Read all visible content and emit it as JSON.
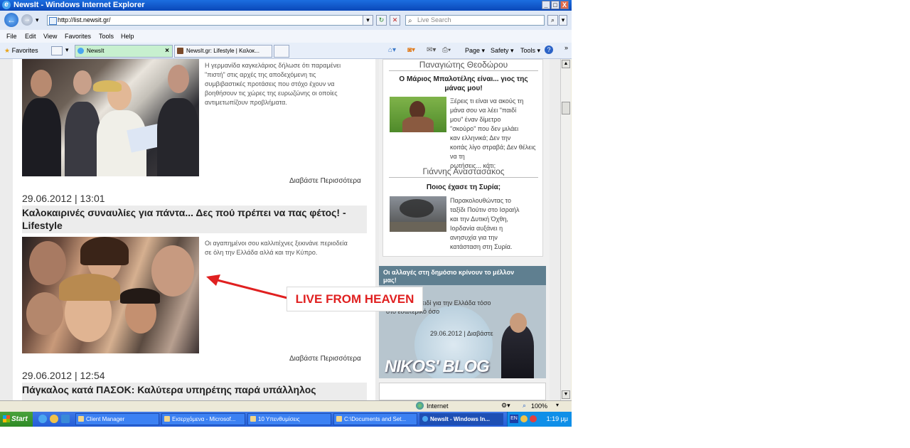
{
  "window": {
    "title": "NewsIt - Windows Internet Explorer",
    "minimize": "_",
    "maximize": "□",
    "close": "X"
  },
  "address": {
    "back": "←",
    "forward": "→",
    "url": "http://list.newsit.gr/",
    "dropdown": "▾",
    "refresh": "↻",
    "stop": "✕",
    "search_placeholder": "Live Search",
    "search_btn": "⌕"
  },
  "menu": [
    "File",
    "Edit",
    "View",
    "Favorites",
    "Tools",
    "Help"
  ],
  "favorites_bar": {
    "label": "Favorites",
    "tabs": [
      {
        "label": "NewsIt",
        "active": true
      },
      {
        "label": "NewsIt.gr: Lifestyle | Καλοκ...",
        "active": false
      }
    ],
    "commands": [
      "Page ▾",
      "Safety ▾",
      "Tools ▾"
    ]
  },
  "articles": [
    {
      "excerpt": [
        "Η γερμανίδα καγκελάριος δήλωσε ότι παραμένει",
        "\"πιστή\" στις αρχές της αποδεχόμενη τις",
        "συμβιβαστικές προτάσεις που στόχο έχουν να",
        "βοηθήσουν τις χώρες της ευρωζώνης οι οποίες",
        "αντιμετωπίζουν προβλήματα."
      ],
      "read_more": "Διαβάστε Περισσότερα"
    },
    {
      "date": "29.06.2012 | 13:01",
      "headline": "Καλοκαιρινές συναυλίες για πάντα... Δες πού πρέπει να πας φέτος! - Lifestyle",
      "excerpt": [
        "Οι αγαπημένοι σου καλλιτέχνες ξεκινάνε περιοδεία",
        "σε όλη την Ελλάδα αλλά και την Κύπρο."
      ],
      "read_more": "Διαβάστε Περισσότερα"
    },
    {
      "date": "29.06.2012 | 12:54",
      "headline": "Πάγκαλος κατά ΠΑΣΟΚ: Καλύτερα υπηρέτης παρά υπάλληλος"
    }
  ],
  "sidebar": {
    "columns": [
      {
        "author": "Παναγιώτης Θεοδώρου",
        "title": [
          "Ο Μάριος Μπαλοτέλης είναι... γιος της",
          "μάνας μου!"
        ],
        "text": [
          "Ξέρεις τι είναι να ακούς τη",
          "μάνα σου να λέει \"παιδί",
          "μου\" έναν δίμετρο",
          "\"σκούρο\" που δεν μιλάει",
          "καν ελληνικά; Δεν την",
          "κοιτάς λίγο στραβά; Δεν θέλεις να τη",
          "ρωτήσεις... κάτι;"
        ]
      },
      {
        "author": "Γιάννης Αναστασάκος",
        "title": [
          "Ποιος έχασε τη Συρία;"
        ],
        "text": [
          "Παρακολουθώντας το",
          "ταξίδι Πούτιν στο Ισραήλ",
          "και την Δυτική Όχθη,",
          "Ιορδανία αυξάνει η",
          "ανησυχία για την",
          "κατάσταση στη Συρία."
        ]
      }
    ],
    "blog": {
      "heading": [
        "Οι αλλαγές στη δημόσιο κρίνουν το μέλλον",
        "μας!"
      ],
      "text": [
        "Σε σημείο κλειδί για την Ελλάδα τόσο",
        "στο εσωτερικό όσο"
      ],
      "date": "29.06.2012 | Διαβάστε",
      "logo": "NIKOS' BLOG"
    }
  },
  "annotation": {
    "label": "LIVE FROM HEAVEN",
    "color": "#e02020"
  },
  "status": {
    "zone": "Internet",
    "zoom": "100%"
  },
  "taskbar": {
    "start": "Start",
    "buttons": [
      {
        "label": "Client Manager",
        "active": false
      },
      {
        "label": "Εισερχόμενα - Microsof...",
        "active": false
      },
      {
        "label": "10 Υπενθυμίσεις",
        "active": false
      },
      {
        "label": "C:\\Documents and Set...",
        "active": false
      },
      {
        "label": "NewsIt - Windows In...",
        "active": true
      }
    ],
    "lang": "EN",
    "clock": "1:19 μμ"
  }
}
